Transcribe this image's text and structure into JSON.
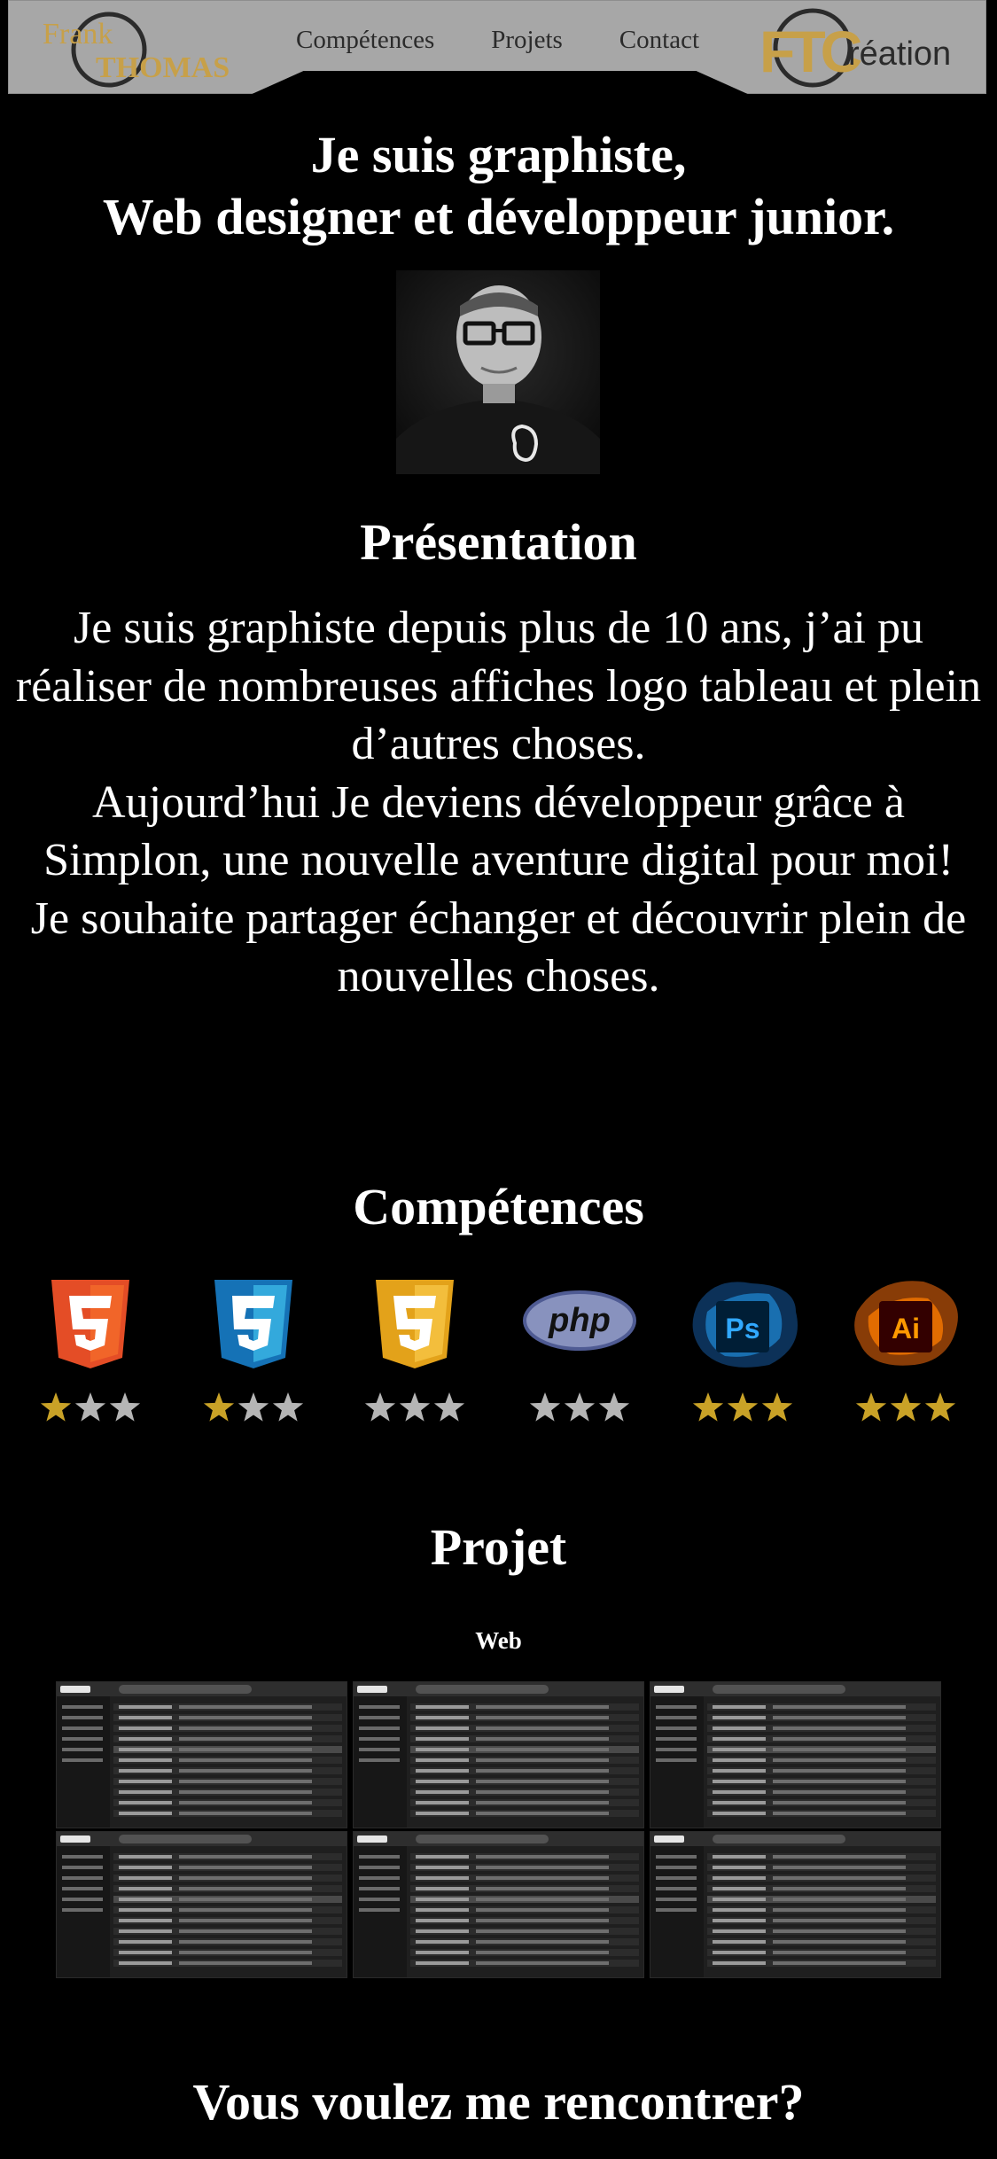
{
  "header": {
    "logo_left": {
      "line1": "Frank",
      "line2": "THOMAS"
    },
    "logo_right": {
      "initials": "FTC",
      "word": "réation"
    },
    "nav": [
      "Compétences",
      "Projets",
      "Contact"
    ]
  },
  "hero": {
    "title_line1": "Je suis graphiste,",
    "title_line2": "Web designer et développeur junior."
  },
  "presentation": {
    "title": "Présentation",
    "text": "Je suis graphiste depuis plus de 10 ans, j’ai pu réaliser de nombreuses affiches logo tableau et plein d’autres choses.\nAujourd’hui Je deviens développeur grâce à Simplon, une nouvelle aventure digital pour moi!\nJe souhaite partager échanger et découvrir plein de nouvelles choses."
  },
  "skills": {
    "title": "Compétences",
    "items": [
      {
        "icon": "html5-icon",
        "color": "#e44d26",
        "rating": 1,
        "max": 3
      },
      {
        "icon": "css3-icon",
        "color": "#2965f1",
        "rating": 1,
        "max": 3
      },
      {
        "icon": "html5-gold-icon",
        "color": "#f0b429",
        "rating": 0,
        "max": 3
      },
      {
        "icon": "php-icon",
        "color": "#8892be",
        "rating": 0,
        "max": 3
      },
      {
        "icon": "photoshop-icon",
        "label": "Ps",
        "color": "#31a8ff",
        "rating": 3,
        "max": 3
      },
      {
        "icon": "illustrator-icon",
        "label": "Ai",
        "color": "#ff9a00",
        "rating": 3,
        "max": 3
      }
    ],
    "star_on": "#c9a227",
    "star_off": "#b5b5b5"
  },
  "projects": {
    "title": "Projet",
    "category": "Web",
    "thumbnail_count": 6
  },
  "contact": {
    "title": "Vous voulez me rencontrer?"
  }
}
